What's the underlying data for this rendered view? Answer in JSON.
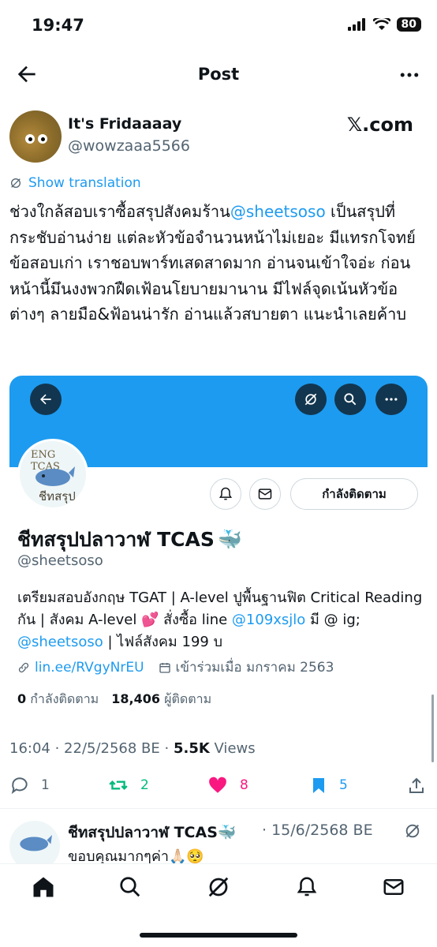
{
  "status_bar": {
    "time": "19:47",
    "battery": "80"
  },
  "header": {
    "title": "Post"
  },
  "author": {
    "name": "It's Fridaaaay",
    "handle": "@wowzaaa5566",
    "badge": "𝕏.com"
  },
  "translate_label": "Show translation",
  "post": {
    "text_1": "ช่วงใกล้สอบเราซื้อสรุปสังคมร้าน",
    "mention": "@sheetsoso",
    "text_2": " เป็นสรุปที่กระชับอ่านง่าย แต่ละหัวข้อจำนวนหน้าไม่เยอะ มีแทรกโจทย์ข้อสอบเก่า เราชอบพาร์ทเสดสาดมาก อ่านจนเข้าใจอ่ะ ก่อนหน้านี้มึนงงพวกฝืดเฟ้อนโยบายมานาน มีไฟล์จุดเน้นหัวข้อต่างๆ ลายมือ&ฟ้อนน่ารัก อ่านแล้วสบายตา แนะนำเลยค้าบ"
  },
  "profile_card": {
    "avatar_text_top": "ENG TCAS",
    "avatar_text_bottom": "ชีทสรุป",
    "follow_label": "กำลังติดตาม",
    "name": "ชีทสรุปปลาวาฬ TCAS",
    "name_emoji": "🐳",
    "handle": "@sheetsoso",
    "bio_1": "เตรียมสอบอังกฤษ TGAT | A-level ปูพื้นฐานฟิต Critical Reading กัน | สังคม A-level 💕 สั่งซื้อ line ",
    "bio_link_1": "@109xsjlo",
    "bio_2": " มี @ ig; ",
    "bio_link_2": "@sheetsoso",
    "bio_3": " | ไฟล์สังคม 199 บ",
    "website": "lin.ee/RVgyNrEU",
    "joined": "เข้าร่วมเมื่อ มกราคม 2563",
    "following_count": "0",
    "following_label": "กำลังติดตาม",
    "followers_count": "18,406",
    "followers_label": "ผู้ติดตาม"
  },
  "meta": {
    "time": "16:04 · 22/5/2568 BE · ",
    "views_count": "5.5K",
    "views_label": " Views"
  },
  "actions": {
    "replies": "1",
    "reposts": "2",
    "likes": "8",
    "bookmarks": "5"
  },
  "colors": {
    "accent": "#1d9bf0",
    "repost": "#00ba7c",
    "like": "#f91880"
  },
  "reply": {
    "name": "ชีทสรุปปลาวาฬ TCAS🐳",
    "date": "· 15/6/2568 BE",
    "text": "ขอบคุณมากๆค่า🙏🏻🥺"
  }
}
